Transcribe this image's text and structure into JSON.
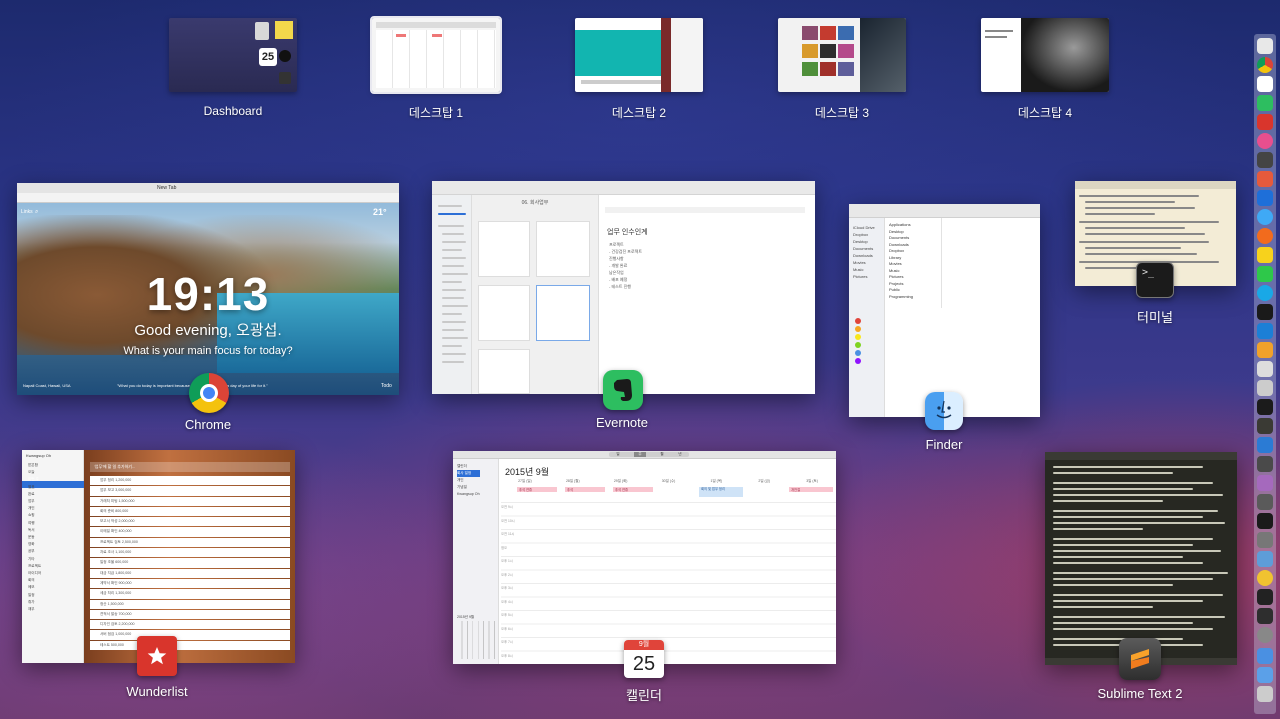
{
  "spaces": [
    {
      "label": "Dashboard"
    },
    {
      "label": "데스크탑 1"
    },
    {
      "label": "데스크탑 2"
    },
    {
      "label": "데스크탑 3"
    },
    {
      "label": "데스크탑 4"
    }
  ],
  "dashboard_widget": {
    "calendar_day": "25"
  },
  "windows": {
    "chrome": {
      "app_label": "Chrome",
      "clock": "19:13",
      "greeting": "Good evening, 오광섭.",
      "focus_prompt": "What is your main focus for today?",
      "links_label": "Links",
      "weather_temp": "21°",
      "location": "Napali Coast, Hawaii, USA",
      "quote": "\"What you do today is important because you are exchanging a day of your life for it.\"",
      "todo_label": "Todo",
      "tab_title": "New Tab"
    },
    "evernote": {
      "app_label": "Evernote",
      "note_title": "업무 인수인계",
      "note_lines": [
        "프로젝트",
        "- 건강검진 프로젝트",
        "진행사항",
        "- 개발 완료",
        "남은작업",
        "- 배포 예정",
        "- 테스트 진행"
      ],
      "list_title": "06. 회사업무"
    },
    "finder": {
      "app_label": "Finder",
      "sidebar": [
        "iCloud Drive",
        "Dropbox",
        "Desktop",
        "Documents",
        "Downloads",
        "Movies",
        "Music",
        "Pictures"
      ],
      "files": [
        "Applications",
        "Desktop",
        "Documents",
        "Downloads",
        "Dropbox",
        "Library",
        "Movies",
        "Music",
        "Pictures",
        "Projects",
        "Public",
        "Programming"
      ]
    },
    "terminal": {
      "app_label": "터미널",
      "prompt_glyph": ">_"
    },
    "wunderlist": {
      "app_label": "Wunderlist",
      "user": "Kwangsup Oh",
      "add_placeholder": "'업무'에 할 일 추가하기...",
      "lists": [
        "받은함",
        "오늘",
        "이번 주",
        "별표",
        "완료",
        "업무",
        "개인",
        "쇼핑",
        "여행",
        "독서",
        "운동",
        "영화",
        "공부",
        "기타",
        "프로젝트",
        "아이디어",
        "회의",
        "메모",
        "일정",
        "휴가",
        "재무"
      ],
      "tasks": [
        "업무 정리 1,200,000",
        "업무 보고 3,000,000",
        "거래처 미팅 1,500,000",
        "회의 준비 800,000",
        "보고서 작성 2,000,000",
        "이메일 확인 400,000",
        "프로젝트 검토 2,500,000",
        "자료 조사 1,100,000",
        "일정 조율 600,000",
        "대금 지급 1,800,000",
        "계약서 확인 900,000",
        "세금 처리 1,300,000",
        "정산 1,500,000",
        "견적서 발송 700,000",
        "디자인 검토 2,200,000",
        "서버 점검 1,000,000",
        "테스트 500,000"
      ]
    },
    "calendar": {
      "app_label": "캘린더",
      "month_title": "2015년 9월",
      "view_tabs": [
        "일",
        "주",
        "월",
        "년"
      ],
      "day_headers": [
        "27일 (일)",
        "28일 (월)",
        "29일 (화)",
        "30일 (수)",
        "1일 (목)",
        "2일 (금)",
        "3일 (토)"
      ],
      "allday_events": [
        "추석 연휴",
        "추석",
        "추석 연휴",
        "개천절"
      ],
      "event_block": "회의 및 업무 정리",
      "hours": [
        "오전 9시",
        "오전 10시",
        "오전 11시",
        "정오",
        "오후 1시",
        "오후 2시",
        "오후 3시",
        "오후 4시",
        "오후 5시",
        "오후 6시",
        "오후 7시",
        "오후 8시"
      ],
      "sidebar_cals": [
        "캘린더",
        "회사 일정",
        "개인",
        "기념일",
        "Kwangsup Oh"
      ],
      "mini_month": "2015년 9월",
      "icon_day": "25",
      "icon_month": "9월"
    },
    "sublime": {
      "app_label": "Sublime Text 2"
    }
  },
  "colors": {
    "accent": "#2d6fd6",
    "wunderlist_red": "#d9352c",
    "evernote_green": "#2dbe60",
    "calendar_red": "#e0443a"
  }
}
